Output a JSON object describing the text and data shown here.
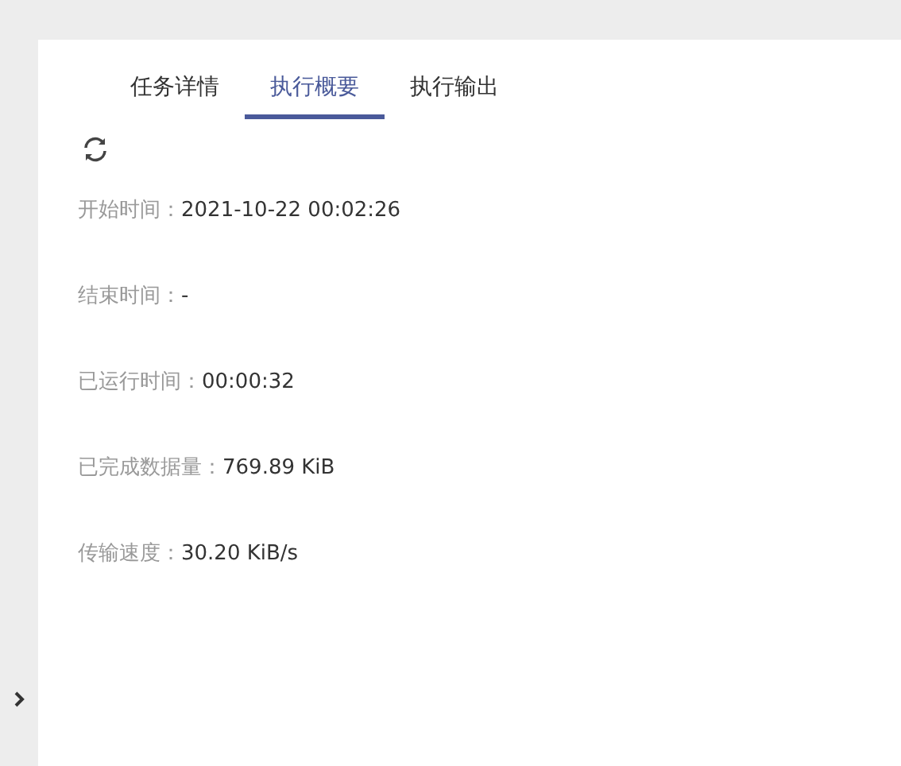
{
  "tabs": [
    {
      "label": "任务详情",
      "selected": false
    },
    {
      "label": "执行概要",
      "selected": true
    },
    {
      "label": "执行输出",
      "selected": false
    }
  ],
  "summary": [
    {
      "label": "开始时间：",
      "value": "2021-10-22 00:02:26"
    },
    {
      "label": "结束时间：",
      "value": "-"
    },
    {
      "label": "已运行时间：",
      "value": "00:00:32"
    },
    {
      "label": "已完成数据量：",
      "value": "769.89 KiB"
    },
    {
      "label": "传输速度：",
      "value": "30.20 KiB/s"
    }
  ]
}
